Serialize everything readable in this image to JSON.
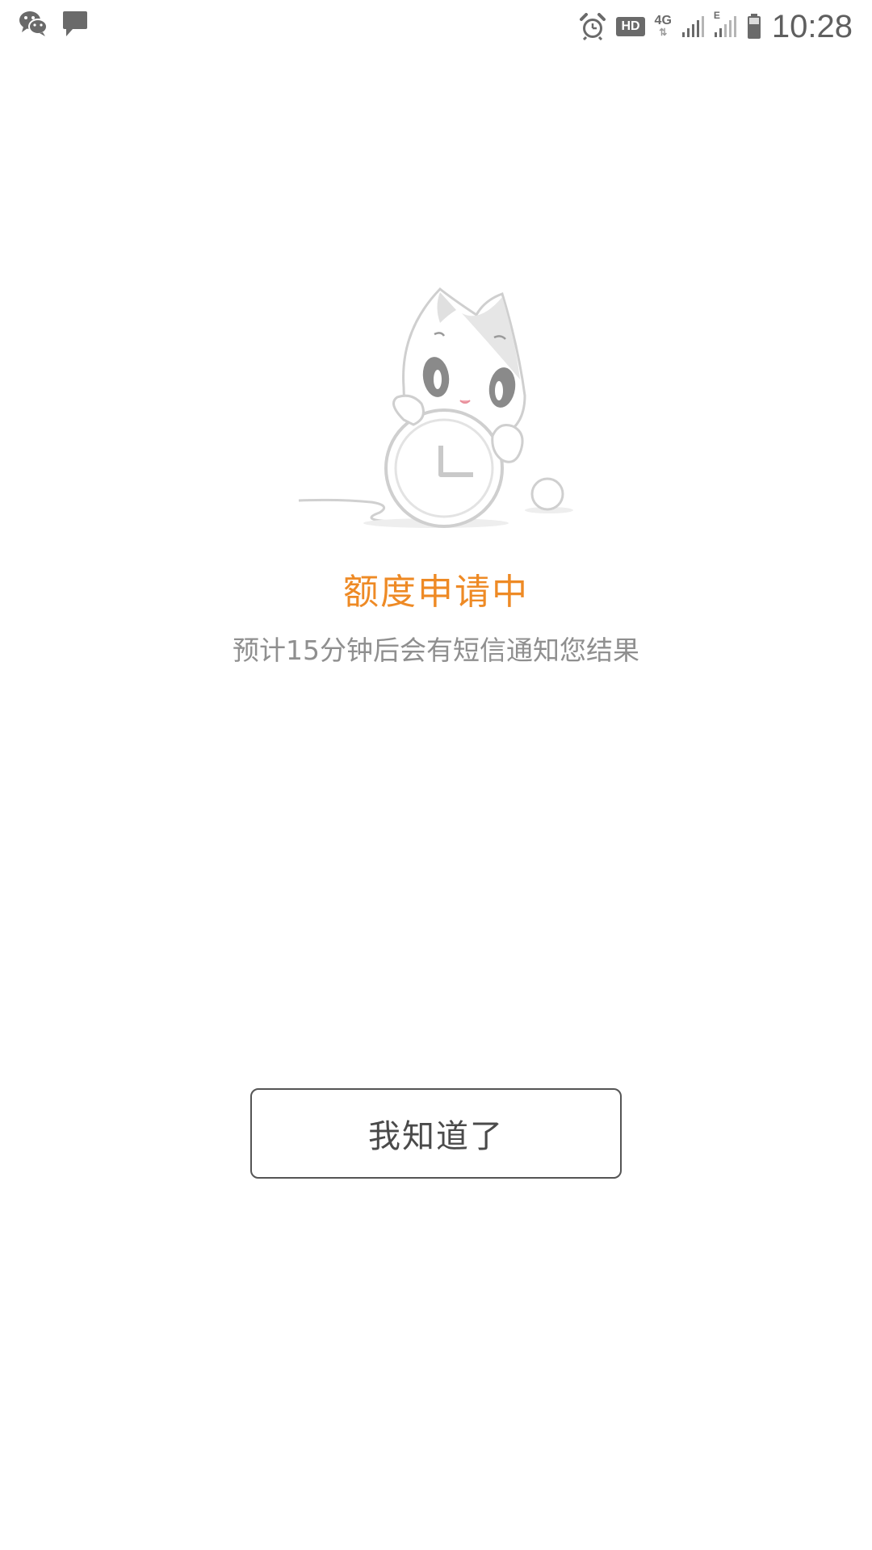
{
  "status_bar": {
    "left_icons": [
      "wechat-icon",
      "message-icon"
    ],
    "right_icons": [
      "alarm-icon",
      "hd-badge",
      "network-4g",
      "signal-icon",
      "signal-e-icon",
      "battery-icon"
    ],
    "hd_label": "HD",
    "network_label": "4G",
    "network_arrows": "⇅",
    "second_signal_label": "E",
    "time": "10:28"
  },
  "status": {
    "title": "额度申请中",
    "message": "预计15分钟后会有短信通知您结果"
  },
  "actions": {
    "confirm_label": "我知道了"
  },
  "colors": {
    "accent": "#ee8a25",
    "subtext": "#8f8f8f",
    "button_text": "#4a4a4a",
    "button_border": "#555555"
  }
}
